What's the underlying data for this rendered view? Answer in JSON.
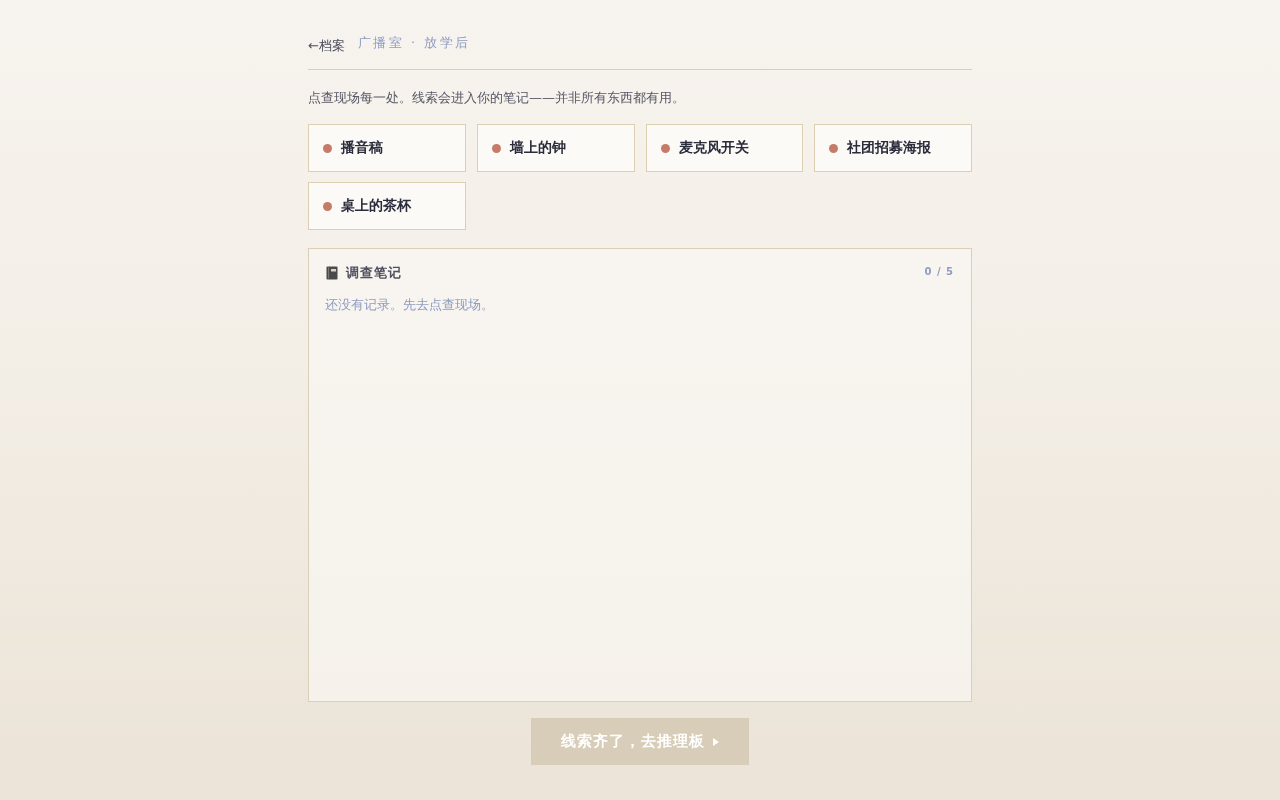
{
  "header": {
    "back_link": "←档案",
    "breadcrumb": "广播室 · 放学后"
  },
  "instruction": "点查现场每一处。线索会进入你的笔记——并非所有东西都有用。",
  "spots": [
    {
      "label": "播音稿",
      "inspected": false
    },
    {
      "label": "墙上的钟",
      "inspected": false
    },
    {
      "label": "麦克风开关",
      "inspected": false
    },
    {
      "label": "社团招募海报",
      "inspected": false
    },
    {
      "label": "桌上的茶杯",
      "inspected": false
    }
  ],
  "notes": {
    "title": "调查笔记",
    "counter": "0 / 5",
    "empty_message": "还没有记录。先去点查现场。"
  },
  "proceed_button": {
    "label": "线索齐了，去推理板",
    "disabled": true
  }
}
